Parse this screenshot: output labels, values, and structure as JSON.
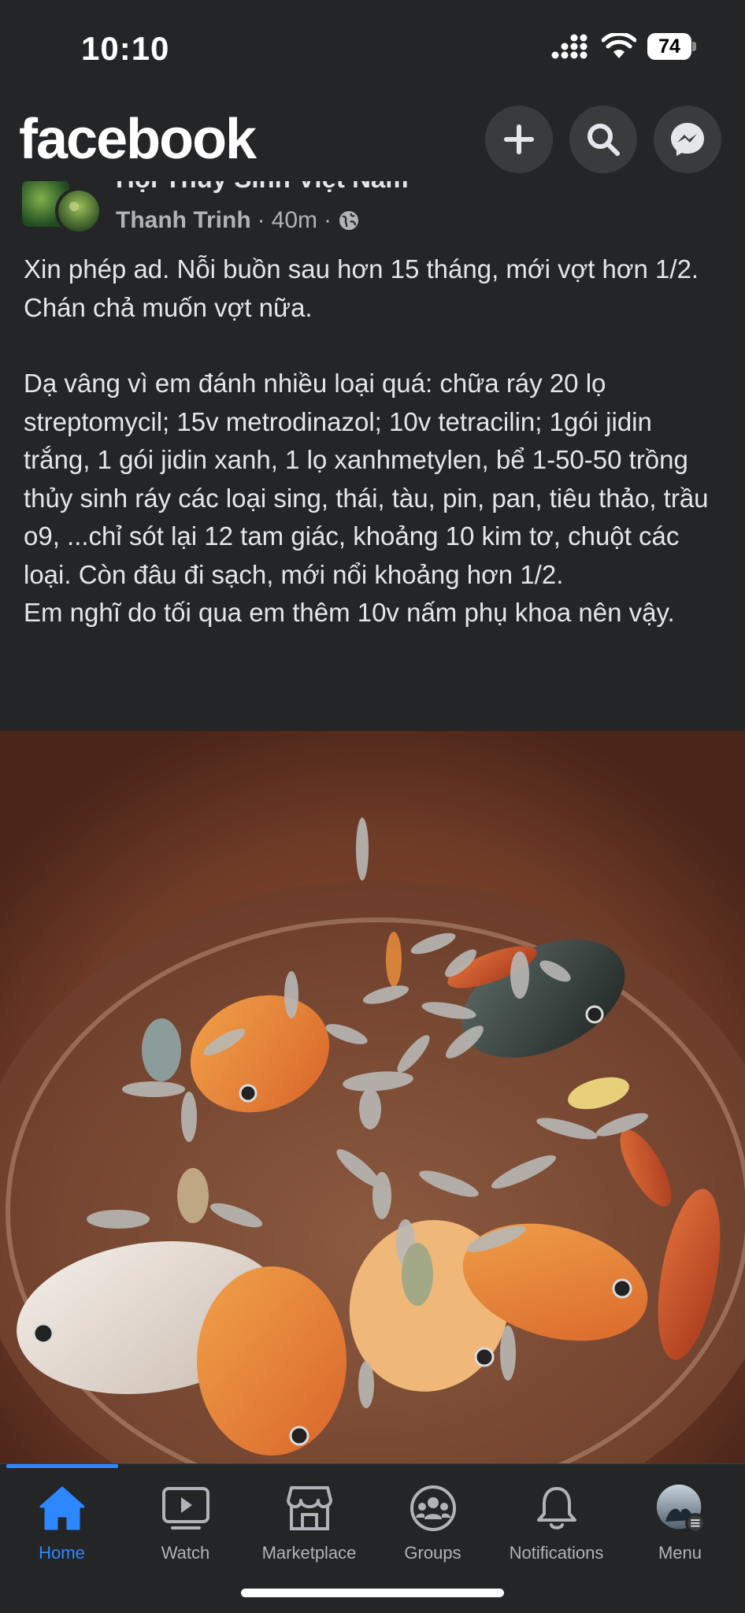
{
  "status_bar": {
    "time": "10:10",
    "battery": "74"
  },
  "header": {
    "logo": "facebook",
    "icons": [
      "plus-icon",
      "search-icon",
      "messenger-icon"
    ]
  },
  "post": {
    "group_name": "Hội Thủy Sinh Việt Nam",
    "author": "Thanh Trinh",
    "time": "40m",
    "separator": "·",
    "privacy_icon": "globe-icon",
    "paragraph1": "Xin phép ad. Nỗi buồn sau hơn 15 tháng, mới vợt hơn 1/2. Chán chả muốn vợt nữa.",
    "paragraph2": "Dạ vâng vì em đánh nhiều loại quá: chữa ráy 20 lọ streptomycil; 15v metrodinazol; 10v tetracilin; 1gói jidin trắng, 1 gói jidin xanh, 1 lọ xanhmetylen, bể 1-50-50 trồng thủy sinh ráy các loại sing, thái, tàu, pin, pan, tiêu thảo, trầu o9, ...chỉ sót lại 12 tam giác, khoảng 10 kim tơ, chuột các loại. Còn đâu đi sạch, mới nổi khoảng hơn 1/2.",
    "paragraph3": "Em nghĩ do tối qua em thêm 10v nấm phụ khoa nên vậy."
  },
  "nav": {
    "items": [
      {
        "label": "Home",
        "icon": "home-icon",
        "active": true
      },
      {
        "label": "Watch",
        "icon": "watch-icon",
        "active": false
      },
      {
        "label": "Marketplace",
        "icon": "marketplace-icon",
        "active": false
      },
      {
        "label": "Groups",
        "icon": "groups-icon",
        "active": false
      },
      {
        "label": "Notifications",
        "icon": "bell-icon",
        "active": false
      },
      {
        "label": "Menu",
        "icon": "menu-avatar",
        "active": false
      }
    ]
  },
  "colors": {
    "background": "#242526",
    "accent": "#2d88ff",
    "text": "#e4e6eb",
    "secondary_text": "#b0b3b8"
  }
}
